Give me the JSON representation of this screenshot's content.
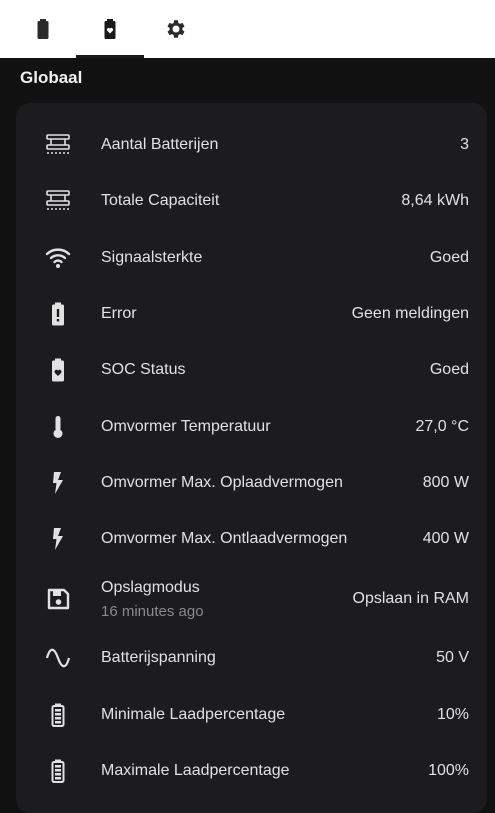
{
  "tabs": [
    {
      "icon": "battery-icon"
    },
    {
      "icon": "battery-heart-icon"
    },
    {
      "icon": "gear-icon"
    }
  ],
  "section_title": "Globaal",
  "rows": [
    {
      "icon": "capacity-icon",
      "label": "Aantal Batterijen",
      "value": "3"
    },
    {
      "icon": "capacity-icon",
      "label": "Totale Capaciteit",
      "value": "8,64 kWh"
    },
    {
      "icon": "wifi-icon",
      "label": "Signaalsterkte",
      "value": "Goed"
    },
    {
      "icon": "battery-alert-icon",
      "label": "Error",
      "value": "Geen meldingen"
    },
    {
      "icon": "battery-heart-icon",
      "label": "SOC Status",
      "value": "Goed"
    },
    {
      "icon": "thermometer-icon",
      "label": "Omvormer Temperatuur",
      "value": "27,0 °C"
    },
    {
      "icon": "lightning-icon",
      "label": "Omvormer Max. Oplaadvermogen",
      "value": "800 W"
    },
    {
      "icon": "lightning-icon",
      "label": "Omvormer Max. Ontlaadvermogen",
      "value": "400 W"
    },
    {
      "icon": "floppy-disk-icon",
      "label": "Opslagmodus",
      "sublabel": "16 minutes ago",
      "value": "Opslaan in RAM"
    },
    {
      "icon": "sine-wave-icon",
      "label": "Batterijspanning",
      "value": "50 V"
    },
    {
      "icon": "battery-level-icon",
      "label": "Minimale Laadpercentage",
      "value": "10%"
    },
    {
      "icon": "battery-level-icon",
      "label": "Maximale Laadpercentage",
      "value": "100%"
    }
  ]
}
